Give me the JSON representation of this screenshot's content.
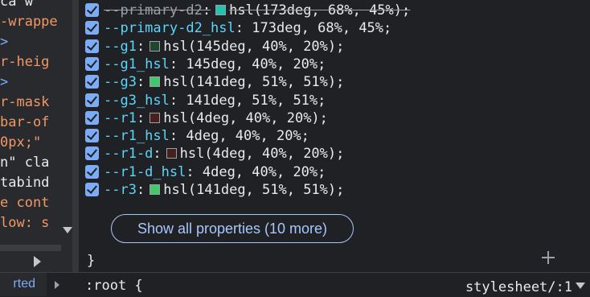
{
  "dom_tree": {
    "lines": [
      {
        "text": "ca w",
        "color": "#e8eaed"
      },
      {
        "text": "-wrappe",
        "color": "#f29766"
      },
      {
        "text": ">",
        "color": "#7cacf8"
      },
      {
        "text": "r-heig",
        "color": "#f29766"
      },
      {
        "text": ">",
        "color": "#7cacf8"
      },
      {
        "text": "r-mask",
        "color": "#f29766"
      },
      {
        "text": "bar-of",
        "color": "#f29766"
      },
      {
        "text": " 0px;\"",
        "color": "#f29766"
      },
      {
        "text": "n\" cla",
        "color": "#e8eaed"
      },
      {
        "text": "tabind",
        "color": "#e8eaed"
      },
      {
        "text": "e cont",
        "color": "#f29766"
      },
      {
        "text": "low: s",
        "color": "#f29766"
      }
    ]
  },
  "styles": {
    "properties": [
      {
        "name": "--primary-d2",
        "value": "hsl(173deg, 68%, 45%);",
        "swatch": "#25c2ad",
        "struck": true
      },
      {
        "name": "--primary-d2_hsl",
        "value": "173deg, 68%, 45%;",
        "swatch": null,
        "struck": false
      },
      {
        "name": "--g1",
        "value": "hsl(145deg, 40%, 20%);",
        "swatch": "#1f472f",
        "struck": false
      },
      {
        "name": "--g1_hsl",
        "value": "145deg, 40%, 20%;",
        "swatch": null,
        "struck": false
      },
      {
        "name": "--g3",
        "value": "hsl(141deg, 51%, 51%);",
        "swatch": "#44c66b",
        "struck": false
      },
      {
        "name": "--g3_hsl",
        "value": "141deg, 51%, 51%;",
        "swatch": null,
        "struck": false
      },
      {
        "name": "--r1",
        "value": "hsl(4deg, 40%, 20%);",
        "swatch": "#471f1c",
        "struck": false
      },
      {
        "name": "--r1_hsl",
        "value": "4deg, 40%, 20%;",
        "swatch": null,
        "struck": false
      },
      {
        "name": "--r1-d",
        "value": "hsl(4deg, 40%, 20%);",
        "swatch": "#471f1c",
        "struck": false
      },
      {
        "name": "--r1-d_hsl",
        "value": "4deg, 40%, 20%;",
        "swatch": null,
        "struck": false
      },
      {
        "name": "--r3",
        "value": "hsl(141deg, 51%, 51%);",
        "swatch": "#44c66b",
        "struck": false
      }
    ],
    "show_all_label": "Show all properties (10 more)",
    "close_brace": "}"
  },
  "bottom_bar": {
    "inherited_label": "rted",
    "root_selector": ":root {",
    "stylesheet_label": "stylesheet/:1"
  },
  "colors": {
    "property_name": "#5cd5fb",
    "checkbox": "#7cacf8",
    "accent": "#a8c7fa"
  }
}
